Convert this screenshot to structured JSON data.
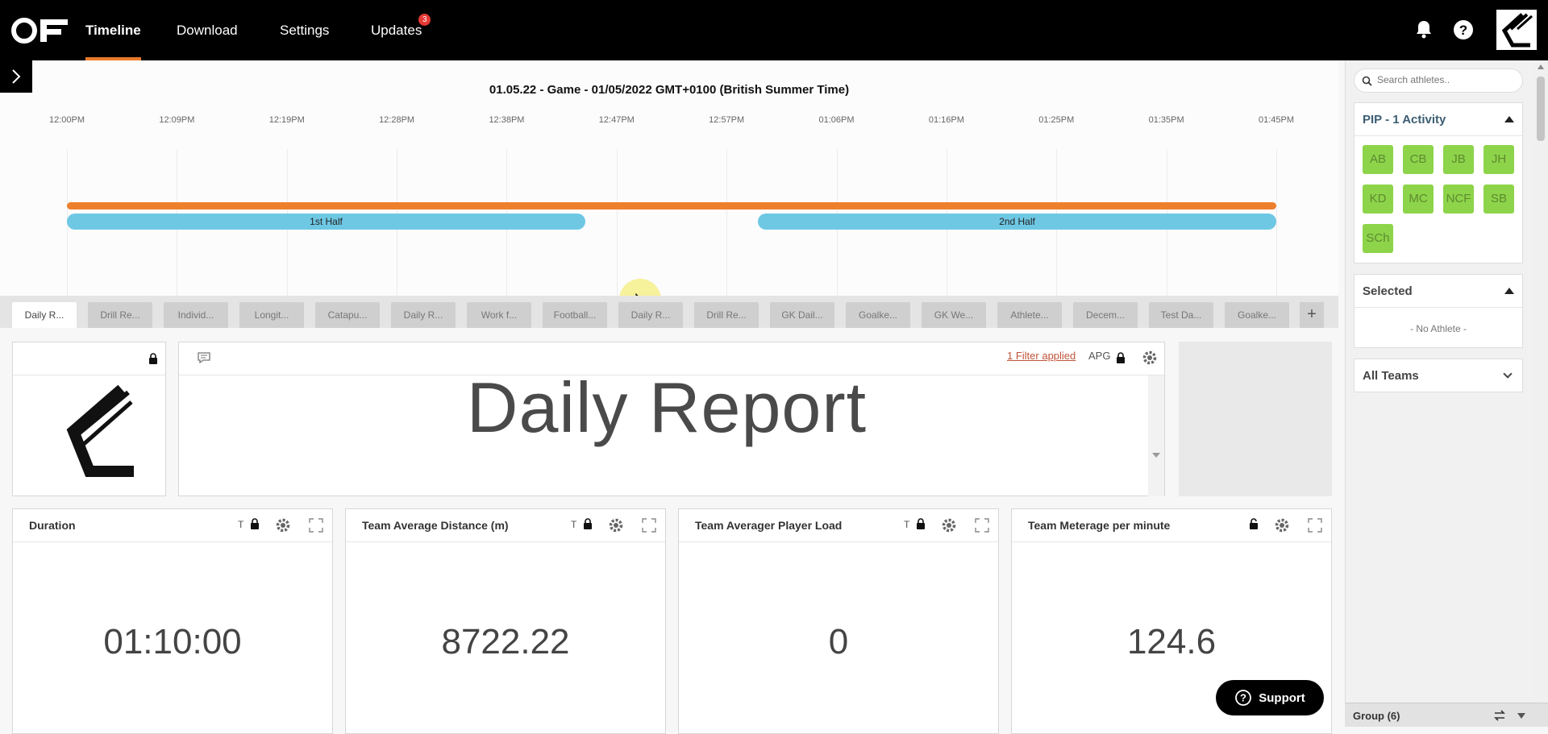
{
  "nav": {
    "items": [
      {
        "label": "Timeline",
        "active": true
      },
      {
        "label": "Download"
      },
      {
        "label": "Settings"
      },
      {
        "label": "Updates",
        "badge": "3"
      }
    ],
    "icons": [
      "bell-icon",
      "help-icon",
      "brand-logo"
    ]
  },
  "timeline": {
    "title": "01.05.22 - Game - 01/05/2022 GMT+0100 (British Summer Time)",
    "ticks": [
      "12:00PM",
      "12:09PM",
      "12:19PM",
      "12:28PM",
      "12:38PM",
      "12:47PM",
      "12:57PM",
      "01:06PM",
      "01:16PM",
      "01:25PM",
      "01:35PM",
      "01:45PM"
    ],
    "periods": [
      {
        "label": "1st Half"
      },
      {
        "label": "2nd Half"
      }
    ],
    "colors": {
      "activity": "#ee7f2d",
      "period": "#6ec8e4"
    }
  },
  "tabs": [
    "Daily R...",
    "Drill Re...",
    "Individ...",
    "Longit...",
    "Catapu...",
    "Daily R...",
    "Work f...",
    "Football...",
    "Daily R...",
    "Drill Re...",
    "GK Dail...",
    "Goalke...",
    "GK We...",
    "Athlete...",
    "Decem...",
    "Test Da...",
    "Goalke..."
  ],
  "tab_add_label": "+",
  "report": {
    "title": "Daily Report",
    "filter_label": "1 Filter applied",
    "apg_label": "APG"
  },
  "kpis": [
    {
      "title": "Duration",
      "value": "01:10:00",
      "t": "T"
    },
    {
      "title": "Team Average Distance (m)",
      "value": "8722.22",
      "t": "T"
    },
    {
      "title": "Team Averager Player Load",
      "value": "0",
      "t": "T"
    },
    {
      "title": "Team Meterage per minute",
      "value": "124.6",
      "t": ""
    }
  ],
  "support_label": "Support",
  "sidebar": {
    "search_placeholder": "Search athletes..",
    "pip_title": "PIP - 1 Activity",
    "athletes": [
      "AB",
      "CB",
      "JB",
      "JH",
      "KD",
      "MC",
      "NCF",
      "SB",
      "SCh"
    ],
    "athlete_color": "#8dd44a",
    "selected_title": "Selected",
    "no_athlete": "- No Athlete -",
    "teams_label": "All Teams",
    "group_label": "Group (6)"
  }
}
